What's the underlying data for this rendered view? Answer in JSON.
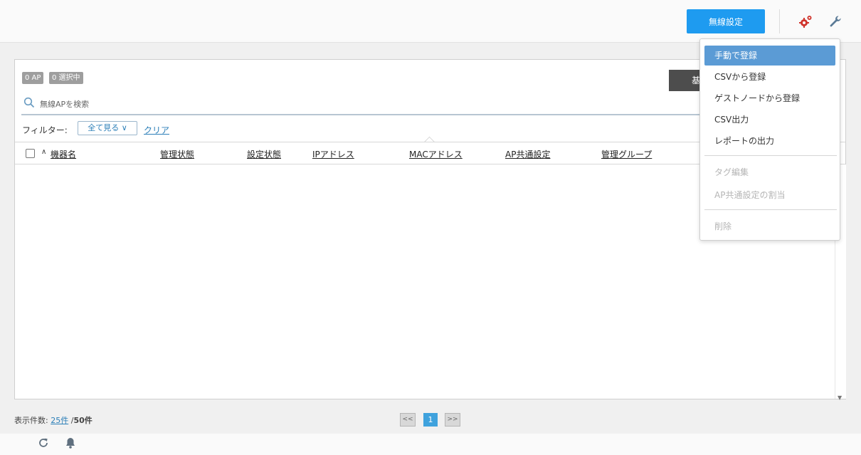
{
  "header": {
    "wireless_settings_label": "無線設定",
    "icons": [
      "gear-icon",
      "wrench-icon"
    ]
  },
  "panel": {
    "badge_ap": "0 AP",
    "badge_selected": "0 選択中",
    "dark_button_label": "基",
    "search": {
      "placeholder": "無線APを検索",
      "value": ""
    },
    "filter": {
      "label": "フィルター:",
      "selected": "全て見る ∨",
      "clear": "クリア"
    },
    "columns": [
      "機器名",
      "管理状態",
      "設定状態",
      "IPアドレス",
      "MACアドレス",
      "AP共通設定",
      "管理グループ"
    ],
    "sort_indicator": "∧"
  },
  "dropdown": {
    "items": [
      {
        "label": "手動で登録",
        "state": "active"
      },
      {
        "label": "CSVから登録",
        "state": "enabled"
      },
      {
        "label": "ゲストノードから登録",
        "state": "enabled"
      },
      {
        "label": "CSV出力",
        "state": "enabled"
      },
      {
        "label": "レポートの出力",
        "state": "enabled"
      },
      {
        "label": "タグ編集",
        "state": "disabled"
      },
      {
        "label": "AP共通設定の割当",
        "state": "disabled"
      },
      {
        "label": "削除",
        "state": "disabled"
      }
    ]
  },
  "footer": {
    "count_label": "表示件数:",
    "per_page": "25件",
    "separator": "/",
    "total": "50件",
    "pager": {
      "prev": "<<",
      "current": "1",
      "next": ">>"
    }
  },
  "colors": {
    "primary_button": "#1e9bf0",
    "menu_active": "#5b9bd5",
    "link": "#2c7fb8",
    "pager_active": "#3fa2dd",
    "gear": "#d0342c"
  }
}
